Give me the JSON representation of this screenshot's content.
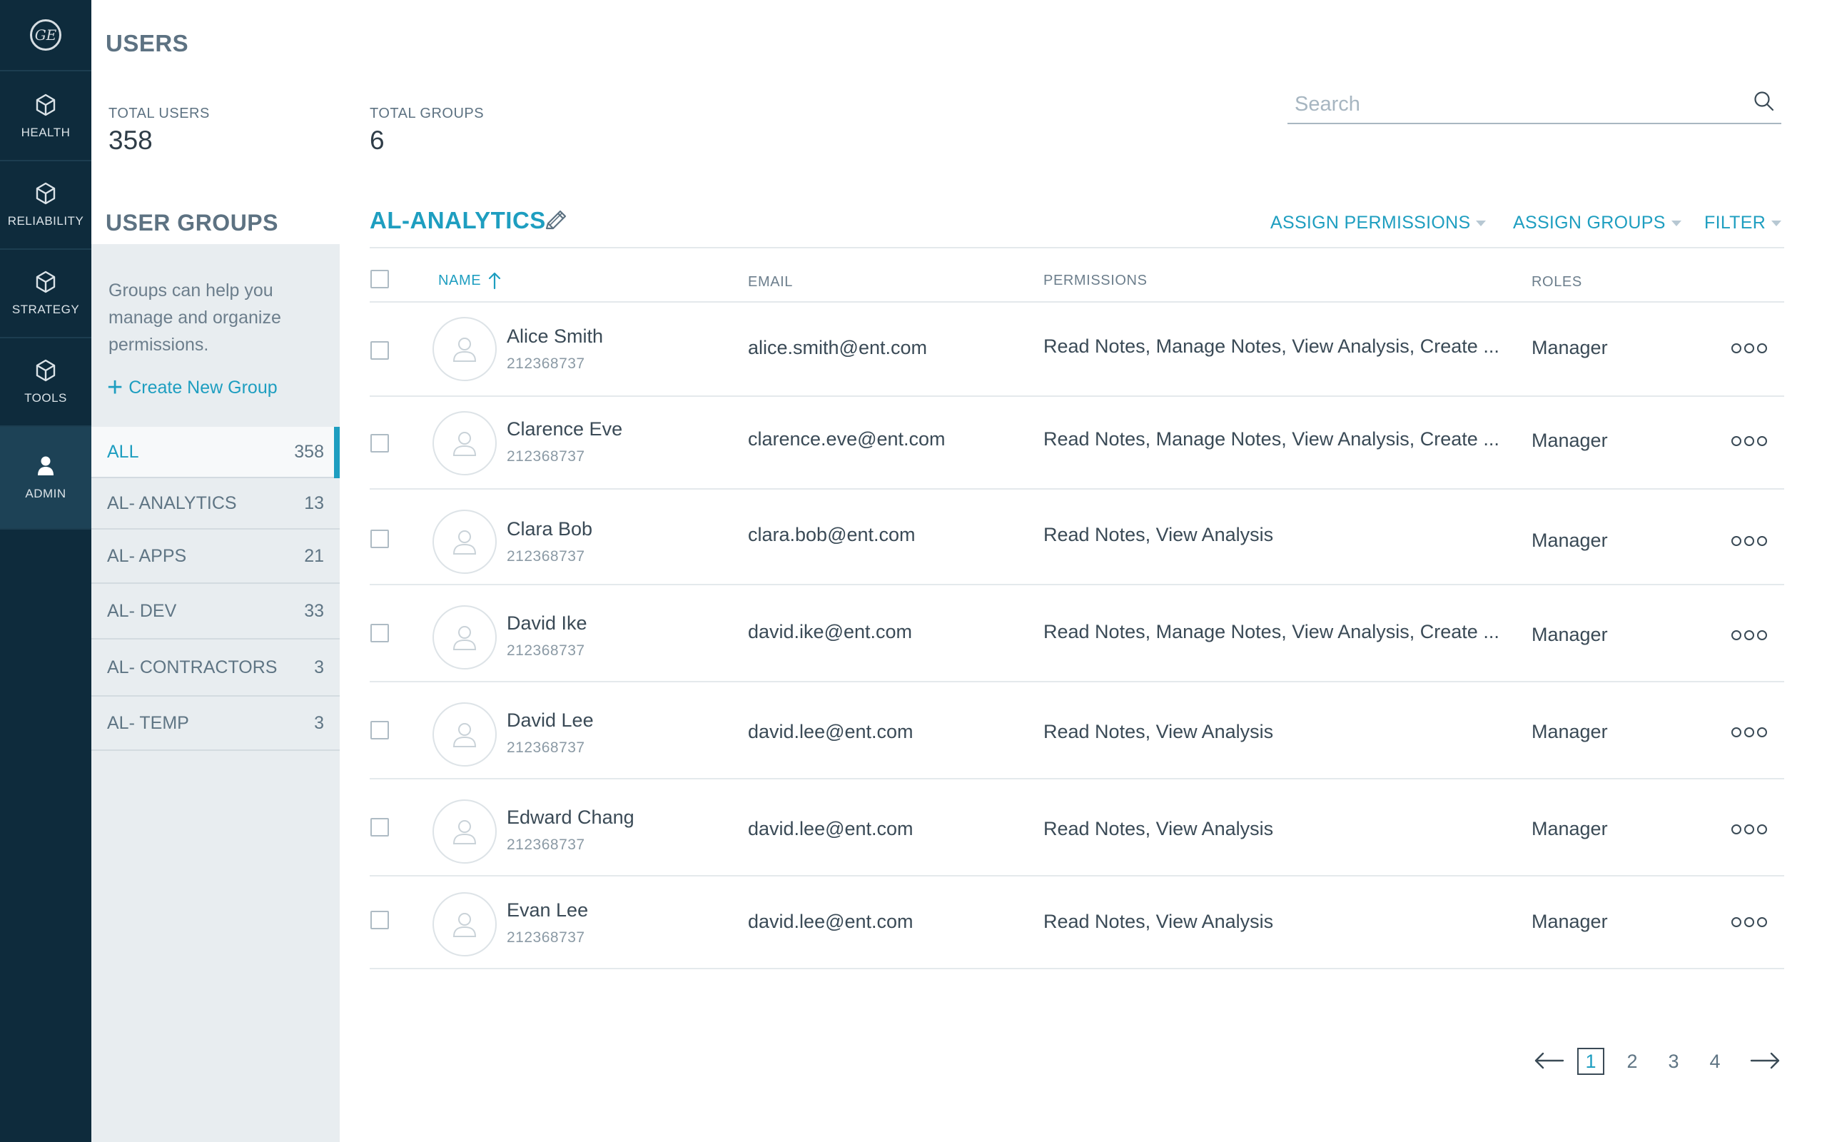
{
  "nav": {
    "logo_text": "GE",
    "items": [
      {
        "label": "HEALTH",
        "icon": "cube-icon"
      },
      {
        "label": "RELIABILITY",
        "icon": "cube-icon"
      },
      {
        "label": "STRATEGY",
        "icon": "cube-icon"
      },
      {
        "label": "TOOLS",
        "icon": "cube-icon"
      },
      {
        "label": "ADMIN",
        "icon": "user-icon",
        "active": true
      }
    ]
  },
  "page": {
    "title": "USERS",
    "stats": {
      "total_users_label": "TOTAL USERS",
      "total_users_value": "358",
      "total_groups_label": "TOTAL GROUPS",
      "total_groups_value": "6"
    },
    "search": {
      "placeholder": "Search",
      "value": ""
    }
  },
  "groups": {
    "title": "USER GROUPS",
    "help": "Groups can help you manage and organize permissions.",
    "create_label": "Create New Group",
    "items": [
      {
        "name": "ALL",
        "count": "358",
        "active": true
      },
      {
        "name": "AL- ANALYTICS",
        "count": "13"
      },
      {
        "name": "AL- APPS",
        "count": "21"
      },
      {
        "name": "AL- DEV",
        "count": "33"
      },
      {
        "name": "AL- CONTRACTORS",
        "count": "3"
      },
      {
        "name": "AL- TEMP",
        "count": "3"
      }
    ]
  },
  "selected_group": {
    "title": "AL-ANALYTICS",
    "actions": {
      "assign_permissions": "ASSIGN PERMISSIONS",
      "assign_groups": "ASSIGN GROUPS",
      "filter": "FILTER"
    }
  },
  "table": {
    "columns": {
      "name": "NAME",
      "email": "EMAIL",
      "permissions": "PERMISSIONS",
      "roles": "ROLES"
    },
    "sort": {
      "column": "name",
      "direction": "ascending"
    },
    "rows": [
      {
        "name": "Alice Smith",
        "id": "212368737",
        "email": "alice.smith@ent.com",
        "permissions": "Read Notes,  Manage Notes, View Analysis, Create ...",
        "role": "Manager"
      },
      {
        "name": "Clarence Eve",
        "id": "212368737",
        "email": "clarence.eve@ent.com",
        "permissions": "Read Notes,  Manage Notes, View Analysis, Create ...",
        "role": "Manager"
      },
      {
        "name": "Clara Bob",
        "id": "212368737",
        "email": "clara.bob@ent.com",
        "permissions": "Read Notes,  View Analysis",
        "role": "Manager"
      },
      {
        "name": "David Ike",
        "id": "212368737",
        "email": "david.ike@ent.com",
        "permissions": "Read Notes,  Manage Notes, View Analysis, Create ...",
        "role": "Manager"
      },
      {
        "name": "David Lee",
        "id": "212368737",
        "email": "david.lee@ent.com",
        "permissions": "Read Notes,  View Analysis",
        "role": "Manager"
      },
      {
        "name": "Edward Chang",
        "id": "212368737",
        "email": "david.lee@ent.com",
        "permissions": "Read Notes,  View Analysis",
        "role": "Manager"
      },
      {
        "name": "Evan Lee",
        "id": "212368737",
        "email": "david.lee@ent.com",
        "permissions": "Read Notes,  View Analysis",
        "role": "Manager"
      }
    ]
  },
  "pagination": {
    "pages": [
      "1",
      "2",
      "3",
      "4"
    ],
    "current": "1"
  },
  "colors": {
    "rail": "#0e2b3c",
    "rail_active": "#1d4256",
    "accent": "#1e9ec0",
    "groups_panel": "#e8edf0"
  }
}
